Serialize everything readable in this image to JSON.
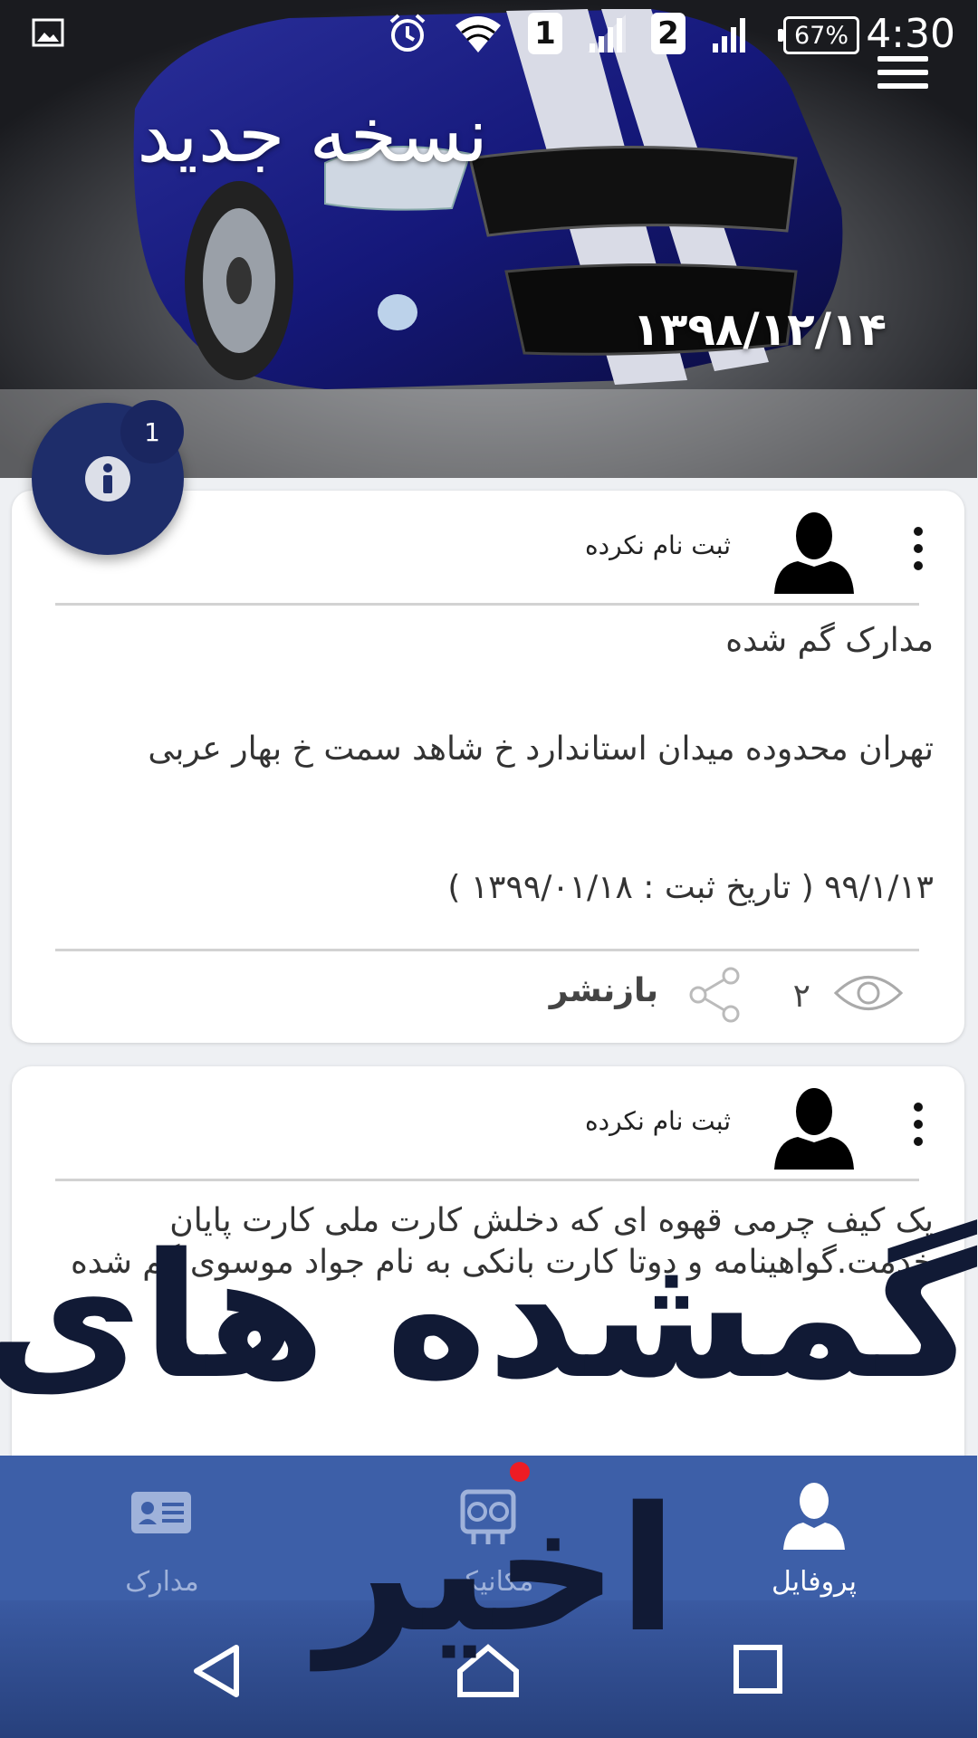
{
  "status_bar": {
    "sim1": "1",
    "sim2": "2",
    "battery": "67%",
    "time": "4:30"
  },
  "hero": {
    "title": "نسخه جدید",
    "date": "۱۳۹۸/۱۲/۱۴"
  },
  "info_fab": {
    "badge": "1"
  },
  "posts": [
    {
      "author": "ثبت نام نکرده",
      "title": "مدارک گم شده",
      "body": "تهران محدوده میدان استاندارد خ شاهد  سمت خ بهار عربی",
      "date_line": "۹۹/۱/۱۳  ( تاریخ ثبت : ۱۳۹۹/۰۱/۱۸ )",
      "views": "۲",
      "share_label": "بازنشر"
    },
    {
      "author": "ثبت نام نکرده",
      "body": "یک کیف چرمی قهوه ای که دخلش کارت ملی کارت پایان خدمت.گواهینامه و دوتا کارت بانکی به نام جواد موسوی گم شده"
    }
  ],
  "overlay": {
    "line1": "گمشده های",
    "line2": "اخیر"
  },
  "bottom_nav": {
    "profile": "پروفایل",
    "mechanic": "مکانیکی",
    "documents": "مدارک"
  },
  "colors": {
    "nav_bg": "#3d5fa8",
    "fab_bg": "#1e2d6a",
    "overlay_text": "#111a35",
    "notification_dot": "#ee1c24"
  }
}
